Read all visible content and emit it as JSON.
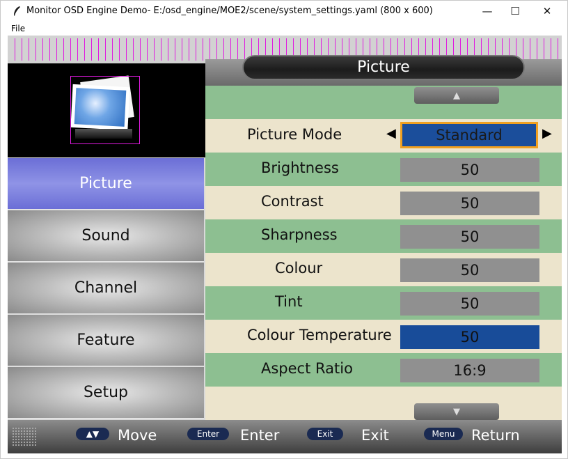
{
  "window": {
    "title": "Monitor OSD Engine Demo- E:/osd_engine/MOE2/scene/system_settings.yaml (800 x 600)",
    "minimize": "—",
    "maximize": "☐",
    "close": "✕"
  },
  "menu": {
    "file": "File"
  },
  "osd": {
    "header_title": "Picture",
    "sidebar": [
      {
        "label": "Picture",
        "selected": true
      },
      {
        "label": "Sound",
        "selected": false
      },
      {
        "label": "Channel",
        "selected": false
      },
      {
        "label": "Feature",
        "selected": false
      },
      {
        "label": "Setup",
        "selected": false
      }
    ],
    "scroll_up": "▲",
    "scroll_down": "▼",
    "rows": [
      {
        "label": "Picture Mode",
        "value": "Standard"
      },
      {
        "label": "Brightness",
        "value": "50"
      },
      {
        "label": "Contrast",
        "value": "50"
      },
      {
        "label": "Sharpness",
        "value": "50"
      },
      {
        "label": "Colour",
        "value": "50"
      },
      {
        "label": "Tint",
        "value": "50"
      },
      {
        "label": "Colour Temperature",
        "value": "50"
      },
      {
        "label": "Aspect Ratio",
        "value": "16:9"
      }
    ],
    "arrow_left": "◀",
    "arrow_right": "▶",
    "footer": {
      "move_key": "▲▼",
      "move_label": "Move",
      "enter_key": "Enter",
      "enter_label": "Enter",
      "exit_key": "Exit",
      "exit_label": "Exit",
      "menu_key": "Menu",
      "menu_label": "Return"
    }
  },
  "colors": {
    "selected_item": "#7f83e0",
    "row_green": "#8dbf91",
    "row_cream": "#ece4cc",
    "value_grey": "#909090",
    "value_blue": "#184c99",
    "focus_border": "#f0a020",
    "debug_grid": "#e01ae0"
  }
}
